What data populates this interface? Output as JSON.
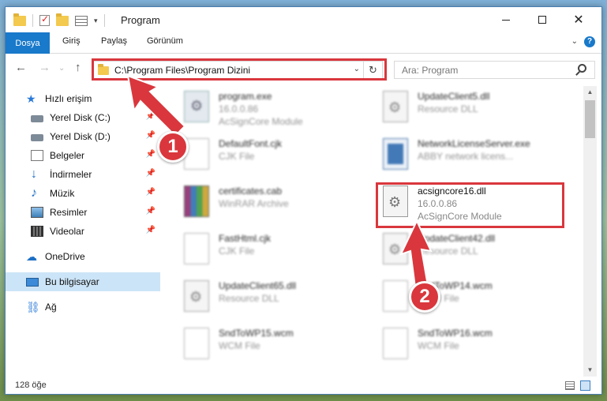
{
  "window": {
    "title": "Program",
    "accent_color": "#1979ca",
    "highlight_color": "#d9373d"
  },
  "ribbon": {
    "tabs": [
      "Dosya",
      "Giriş",
      "Paylaş",
      "Görünüm"
    ],
    "help": "?"
  },
  "nav": {
    "address": "C:\\Program Files\\Program Dizini",
    "search_placeholder": "Ara: Program"
  },
  "sidebar": {
    "items": [
      {
        "label": "Hızlı erişim",
        "icon": "star-icon"
      },
      {
        "label": "Yerel Disk (C:)",
        "icon": "drive-icon"
      },
      {
        "label": "Yerel Disk (D:)",
        "icon": "drive-icon"
      },
      {
        "label": "Belgeler",
        "icon": "document-icon"
      },
      {
        "label": "İndirmeler",
        "icon": "download-icon"
      },
      {
        "label": "Müzik",
        "icon": "music-icon"
      },
      {
        "label": "Resimler",
        "icon": "picture-icon"
      },
      {
        "label": "Videolar",
        "icon": "video-icon"
      },
      {
        "label": "OneDrive",
        "icon": "cloud-icon"
      },
      {
        "label": "Bu bilgisayar",
        "icon": "computer-icon"
      },
      {
        "label": "Ağ",
        "icon": "network-icon"
      }
    ]
  },
  "files": [
    {
      "name": "program.exe",
      "line2": "16.0.0.86",
      "line3": "AcSignCore Module"
    },
    {
      "name": "UpdateClient5.dll",
      "line2": "Resource DLL",
      "line3": ""
    },
    {
      "name": "DefaultFont.cjk",
      "line2": "CJK File",
      "line3": ""
    },
    {
      "name": "NetworkLicenseServer.exe",
      "line2": "ABBY network licens...",
      "line3": ""
    },
    {
      "name": "certificates.cab",
      "line2": "WinRAR Archive",
      "line3": ""
    },
    {
      "name": "acsigncore16.dll",
      "line2": "16.0.0.86",
      "line3": "AcSignCore Module"
    },
    {
      "name": "FastHtml.cjk",
      "line2": "CJK File",
      "line3": ""
    },
    {
      "name": "UpdateClient42.dll",
      "line2": "Resource DLL",
      "line3": ""
    },
    {
      "name": "UpdateClient65.dll",
      "line2": "Resource DLL",
      "line3": ""
    },
    {
      "name": "SndToWP14.wcm",
      "line2": "WCM File",
      "line3": ""
    },
    {
      "name": "SndToWP15.wcm",
      "line2": "WCM File",
      "line3": ""
    },
    {
      "name": "SndToWP16.wcm",
      "line2": "WCM File",
      "line3": ""
    }
  ],
  "status": {
    "count": "128 öğe"
  },
  "annotations": {
    "badge1": "1",
    "badge2": "2"
  }
}
